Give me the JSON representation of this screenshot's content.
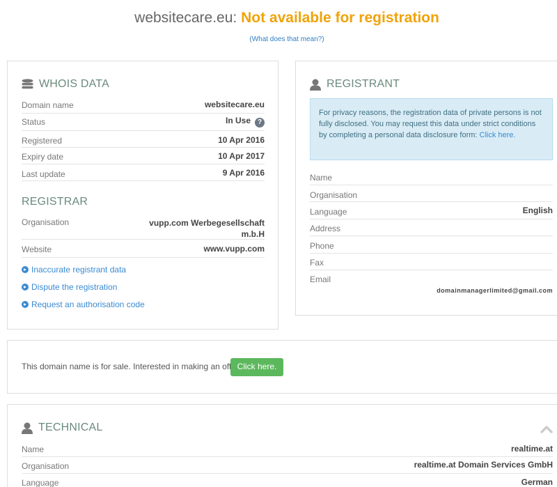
{
  "header": {
    "domain": "websitecare.eu:",
    "status": "Not available for registration",
    "what_link": "(What does that mean?)"
  },
  "whois": {
    "title": "WHOIS DATA",
    "rows": [
      {
        "label": "Domain name",
        "value": "websitecare.eu"
      },
      {
        "label": "Status",
        "value": "In Use"
      },
      {
        "label": "Registered",
        "value": "10 Apr 2016"
      },
      {
        "label": "Expiry date",
        "value": "10 Apr 2017"
      },
      {
        "label": "Last update",
        "value": "9 Apr 2016"
      }
    ]
  },
  "registrar": {
    "title": "REGISTRAR",
    "org_label": "Organisation",
    "org_value_1": "vupp.com Werbegesellschaft",
    "org_value_2": "m.b.H",
    "web_label": "Website",
    "web_value": "www.vupp.com",
    "links": [
      "Inaccurate registrant data",
      "Dispute the registration",
      "Request an authorisation code"
    ]
  },
  "registrant": {
    "title": "REGISTRANT",
    "notice": "For privacy reasons, the registration data of private persons is not fully disclosed. You may request this data under strict conditions by completing a personal data disclosure form:",
    "notice_link": "Click here.",
    "rows": [
      {
        "label": "Name",
        "value": ""
      },
      {
        "label": "Organisation",
        "value": ""
      },
      {
        "label": "Language",
        "value": "English"
      },
      {
        "label": "Address",
        "value": ""
      },
      {
        "label": "Phone",
        "value": ""
      },
      {
        "label": "Fax",
        "value": ""
      }
    ],
    "email_label": "Email",
    "email_value": "domainmanagerlimited@gmail.com"
  },
  "sale": {
    "text": "This domain name is for sale. Interested in making an offer?",
    "button": "Click here."
  },
  "technical": {
    "title": "TECHNICAL",
    "rows": [
      {
        "label": "Name",
        "value": "realtime.at"
      },
      {
        "label": "Organisation",
        "value": "realtime.at Domain Services GmbH"
      },
      {
        "label": "Language",
        "value": "German"
      }
    ]
  },
  "icons": {
    "whois": "database-icon",
    "person": "user-icon",
    "help": "question-circle-icon",
    "link": "arrow-circle-right-icon",
    "collapse": "chevron-up-icon"
  },
  "colors": {
    "status": "#f0a30a",
    "link": "#3a8ad1",
    "heading": "#6a8a7c",
    "button": "#5cb85c",
    "notice_bg": "#d9ecf6"
  }
}
